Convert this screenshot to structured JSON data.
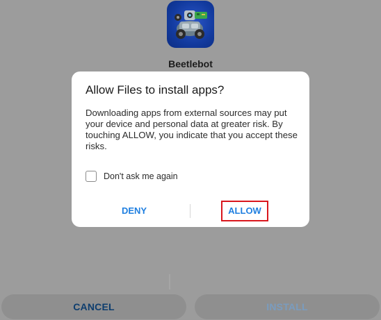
{
  "installer": {
    "app_name": "Beetlebot",
    "app_icon": "beetlebot-app-icon",
    "cancel_label": "CANCEL",
    "install_label": "INSTALL"
  },
  "dialog": {
    "title": "Allow Files to install apps?",
    "message": "Downloading apps from external sources may put your device and personal data at greater risk. By touching ALLOW, you indicate that you accept these risks.",
    "checkbox_label": "Don't ask me again",
    "checkbox_checked": false,
    "deny_label": "DENY",
    "allow_label": "ALLOW"
  },
  "colors": {
    "accent": "#1f7fe0",
    "highlight_box": "#d9161d",
    "scrim": "#9c9c9c"
  }
}
